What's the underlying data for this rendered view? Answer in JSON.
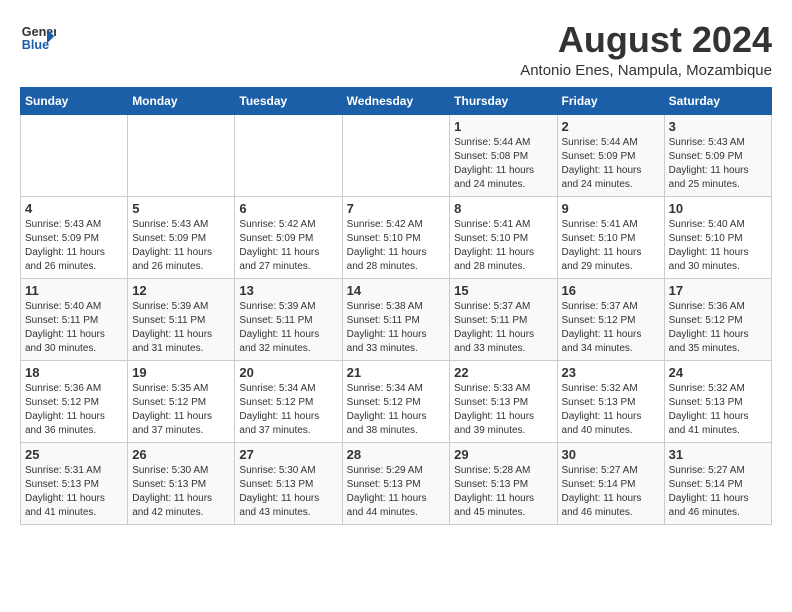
{
  "header": {
    "logo_line1": "General",
    "logo_line2": "Blue",
    "month_year": "August 2024",
    "location": "Antonio Enes, Nampula, Mozambique"
  },
  "weekdays": [
    "Sunday",
    "Monday",
    "Tuesday",
    "Wednesday",
    "Thursday",
    "Friday",
    "Saturday"
  ],
  "weeks": [
    [
      {
        "day": "",
        "detail": ""
      },
      {
        "day": "",
        "detail": ""
      },
      {
        "day": "",
        "detail": ""
      },
      {
        "day": "",
        "detail": ""
      },
      {
        "day": "1",
        "detail": "Sunrise: 5:44 AM\nSunset: 5:08 PM\nDaylight: 11 hours and 24 minutes."
      },
      {
        "day": "2",
        "detail": "Sunrise: 5:44 AM\nSunset: 5:09 PM\nDaylight: 11 hours and 24 minutes."
      },
      {
        "day": "3",
        "detail": "Sunrise: 5:43 AM\nSunset: 5:09 PM\nDaylight: 11 hours and 25 minutes."
      }
    ],
    [
      {
        "day": "4",
        "detail": "Sunrise: 5:43 AM\nSunset: 5:09 PM\nDaylight: 11 hours and 26 minutes."
      },
      {
        "day": "5",
        "detail": "Sunrise: 5:43 AM\nSunset: 5:09 PM\nDaylight: 11 hours and 26 minutes."
      },
      {
        "day": "6",
        "detail": "Sunrise: 5:42 AM\nSunset: 5:09 PM\nDaylight: 11 hours and 27 minutes."
      },
      {
        "day": "7",
        "detail": "Sunrise: 5:42 AM\nSunset: 5:10 PM\nDaylight: 11 hours and 28 minutes."
      },
      {
        "day": "8",
        "detail": "Sunrise: 5:41 AM\nSunset: 5:10 PM\nDaylight: 11 hours and 28 minutes."
      },
      {
        "day": "9",
        "detail": "Sunrise: 5:41 AM\nSunset: 5:10 PM\nDaylight: 11 hours and 29 minutes."
      },
      {
        "day": "10",
        "detail": "Sunrise: 5:40 AM\nSunset: 5:10 PM\nDaylight: 11 hours and 30 minutes."
      }
    ],
    [
      {
        "day": "11",
        "detail": "Sunrise: 5:40 AM\nSunset: 5:11 PM\nDaylight: 11 hours and 30 minutes."
      },
      {
        "day": "12",
        "detail": "Sunrise: 5:39 AM\nSunset: 5:11 PM\nDaylight: 11 hours and 31 minutes."
      },
      {
        "day": "13",
        "detail": "Sunrise: 5:39 AM\nSunset: 5:11 PM\nDaylight: 11 hours and 32 minutes."
      },
      {
        "day": "14",
        "detail": "Sunrise: 5:38 AM\nSunset: 5:11 PM\nDaylight: 11 hours and 33 minutes."
      },
      {
        "day": "15",
        "detail": "Sunrise: 5:37 AM\nSunset: 5:11 PM\nDaylight: 11 hours and 33 minutes."
      },
      {
        "day": "16",
        "detail": "Sunrise: 5:37 AM\nSunset: 5:12 PM\nDaylight: 11 hours and 34 minutes."
      },
      {
        "day": "17",
        "detail": "Sunrise: 5:36 AM\nSunset: 5:12 PM\nDaylight: 11 hours and 35 minutes."
      }
    ],
    [
      {
        "day": "18",
        "detail": "Sunrise: 5:36 AM\nSunset: 5:12 PM\nDaylight: 11 hours and 36 minutes."
      },
      {
        "day": "19",
        "detail": "Sunrise: 5:35 AM\nSunset: 5:12 PM\nDaylight: 11 hours and 37 minutes."
      },
      {
        "day": "20",
        "detail": "Sunrise: 5:34 AM\nSunset: 5:12 PM\nDaylight: 11 hours and 37 minutes."
      },
      {
        "day": "21",
        "detail": "Sunrise: 5:34 AM\nSunset: 5:12 PM\nDaylight: 11 hours and 38 minutes."
      },
      {
        "day": "22",
        "detail": "Sunrise: 5:33 AM\nSunset: 5:13 PM\nDaylight: 11 hours and 39 minutes."
      },
      {
        "day": "23",
        "detail": "Sunrise: 5:32 AM\nSunset: 5:13 PM\nDaylight: 11 hours and 40 minutes."
      },
      {
        "day": "24",
        "detail": "Sunrise: 5:32 AM\nSunset: 5:13 PM\nDaylight: 11 hours and 41 minutes."
      }
    ],
    [
      {
        "day": "25",
        "detail": "Sunrise: 5:31 AM\nSunset: 5:13 PM\nDaylight: 11 hours and 41 minutes."
      },
      {
        "day": "26",
        "detail": "Sunrise: 5:30 AM\nSunset: 5:13 PM\nDaylight: 11 hours and 42 minutes."
      },
      {
        "day": "27",
        "detail": "Sunrise: 5:30 AM\nSunset: 5:13 PM\nDaylight: 11 hours and 43 minutes."
      },
      {
        "day": "28",
        "detail": "Sunrise: 5:29 AM\nSunset: 5:13 PM\nDaylight: 11 hours and 44 minutes."
      },
      {
        "day": "29",
        "detail": "Sunrise: 5:28 AM\nSunset: 5:13 PM\nDaylight: 11 hours and 45 minutes."
      },
      {
        "day": "30",
        "detail": "Sunrise: 5:27 AM\nSunset: 5:14 PM\nDaylight: 11 hours and 46 minutes."
      },
      {
        "day": "31",
        "detail": "Sunrise: 5:27 AM\nSunset: 5:14 PM\nDaylight: 11 hours and 46 minutes."
      }
    ]
  ]
}
